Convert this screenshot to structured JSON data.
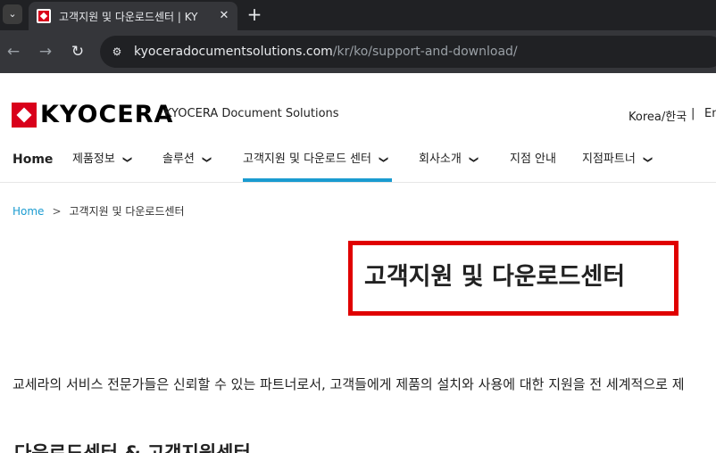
{
  "browser": {
    "tab_title": "고객지원 및 다운로드센터 | KY",
    "tab_close": "✕",
    "new_tab": "+",
    "url_host": "kyoceradocumentsolutions.com",
    "url_path": "/kr/ko/support-and-download/",
    "icons": [
      "tab-search-icon",
      "favicon-icon",
      "close-icon",
      "plus-icon",
      "back-icon",
      "forward-icon",
      "reload-icon",
      "site-info-icon"
    ]
  },
  "header": {
    "logo_text": "KYOCERA",
    "brand_subtitle": "KYOCERA Document Solutions",
    "lang_current": "Korea/한국",
    "lang_sep": "|",
    "lang_alt": "En",
    "brand_color": "#d9001b"
  },
  "nav": {
    "home": "Home",
    "items": [
      {
        "label": "제품정보",
        "has_menu": true
      },
      {
        "label": "솔루션",
        "has_menu": true
      },
      {
        "label": "고객지원 및 다운로드 센터",
        "has_menu": true,
        "active": true
      },
      {
        "label": "회사소개",
        "has_menu": true
      },
      {
        "label": "지점 안내",
        "has_menu": false
      },
      {
        "label": "지점파트너",
        "has_menu": true
      }
    ],
    "active_color": "#1a9bd0"
  },
  "breadcrumb": {
    "home": "Home",
    "separator": ">",
    "current": "고객지원 및 다운로드센터"
  },
  "main": {
    "title": "고객지원 및 다운로드센터",
    "highlight_color": "#e00000",
    "intro": "교세라의 서비스 전문가들은 신뢰할 수 있는 파트너로서, 고객들에게 제품의 설치와 사용에 대한 지원을 전 세계적으로 제",
    "section_heading": "다운로드센터 & 고객지원센터"
  }
}
